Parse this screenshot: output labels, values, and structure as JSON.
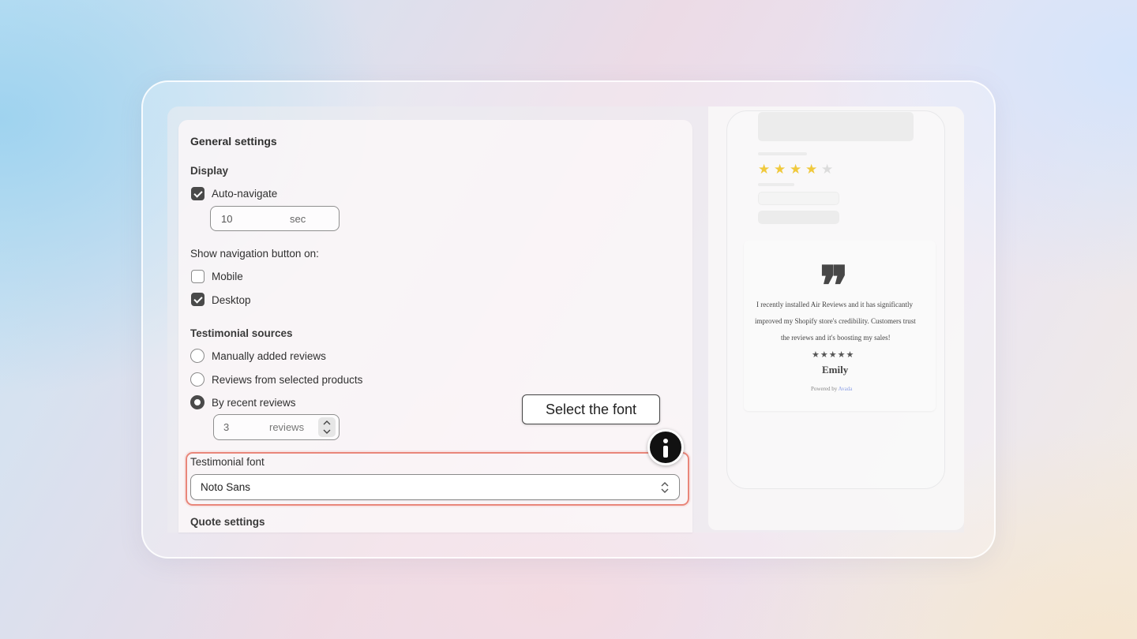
{
  "general": {
    "title": "General settings",
    "display_label": "Display",
    "auto_navigate_label": "Auto-navigate",
    "interval_value": "10",
    "interval_unit": "sec",
    "show_nav_label": "Show navigation button on:",
    "mobile_label": "Mobile",
    "desktop_label": "Desktop",
    "sources_label": "Testimonial sources",
    "source_manual": "Manually added reviews",
    "source_products": "Reviews from selected products",
    "source_recent": "By recent reviews",
    "recent_count": "3",
    "recent_unit": "reviews",
    "font_label": "Testimonial font",
    "font_value": "Noto Sans",
    "quote_settings_label": "Quote settings"
  },
  "state": {
    "auto_navigate": true,
    "mobile": false,
    "desktop": true,
    "selected_source": "By recent reviews"
  },
  "tooltip": {
    "text": "Select the font",
    "icon": "info-icon"
  },
  "preview": {
    "top_rating_stars": 4,
    "top_rating_max": 5,
    "quote_icon": "quote-icon",
    "review_line1": "I recently installed Air Reviews and it has significantly",
    "review_line2": "improved my Shopify store's credibility. Customers trust",
    "review_line3": "the reviews and it's boosting my sales!",
    "review_stars": 5,
    "reviewer": "Emily",
    "powered_by": "Powered by",
    "brand": "Avada"
  },
  "colors": {
    "highlight": "#e9867a",
    "star_gold": "#f0c93c",
    "control_dark": "#4a4a4a",
    "brand_link": "#8ea1e6"
  }
}
